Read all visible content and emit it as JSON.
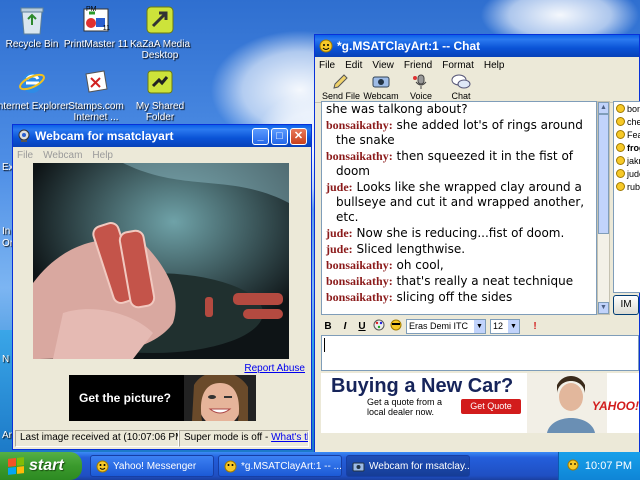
{
  "desktop": {
    "icons": [
      {
        "label": "Recycle Bin",
        "icon": "recycle-bin-icon"
      },
      {
        "label": "PrintMaster 11",
        "icon": "printmaster-icon",
        "badge_top": "PM",
        "badge_num": "11"
      },
      {
        "label": "KaZaA Media Desktop",
        "icon": "kazaa-icon"
      },
      {
        "label": "Internet Explorer",
        "icon": "ie-icon"
      },
      {
        "label": "Stamps.com Internet ...",
        "icon": "stamps-icon"
      },
      {
        "label": "My Shared Folder",
        "icon": "shared-folder-icon"
      }
    ],
    "edge_labels": [
      "Ex",
      "In",
      "Or",
      "N",
      "Ar"
    ]
  },
  "webcam_window": {
    "title": "Webcam for msatclayart",
    "menu": [
      "File",
      "Webcam",
      "Help"
    ],
    "report_abuse": "Report Abuse",
    "ad_text": "Get the picture?",
    "status_left": "Last image received at (10:07:06 PM)",
    "status_right": "Super mode is off - ",
    "status_link": "What's this?"
  },
  "chat_window": {
    "title": "*g.MSATClayArt:1  -- Chat",
    "menu": [
      "File",
      "Edit",
      "View",
      "Friend",
      "Format",
      "Help"
    ],
    "toolbar": [
      {
        "label": "Send File",
        "icon": "send-file-icon"
      },
      {
        "label": "Webcam",
        "icon": "webcam-icon"
      },
      {
        "label": "Voice",
        "icon": "microphone-icon"
      },
      {
        "label": "Chat",
        "icon": "chat-bubbles-icon"
      }
    ],
    "messages": [
      {
        "who": "",
        "text": "she was talkong about?"
      },
      {
        "who": "bonsaikathy:",
        "text": "she added lot's of rings around the snake"
      },
      {
        "who": "bonsaikathy:",
        "text": "then squeezed it in the fist of doom"
      },
      {
        "who": "jude:",
        "text": "Looks like she wrapped clay around a bullseye and cut it and wrapped another, etc."
      },
      {
        "who": "jude:",
        "text": "Now she is reducing...fist of doom."
      },
      {
        "who": "jude:",
        "text": "Sliced lengthwise."
      },
      {
        "who": "bonsaikathy:",
        "text": "oh cool,"
      },
      {
        "who": "bonsaikathy:",
        "text": "that's really a neat technique"
      },
      {
        "who": "bonsaikathy:",
        "text": "slicing off the sides"
      }
    ],
    "friends": [
      {
        "name": "bonsa",
        "bold": false
      },
      {
        "name": "chelyh",
        "bold": false
      },
      {
        "name": "Fearle",
        "bold": false
      },
      {
        "name": "frogg",
        "bold": true
      },
      {
        "name": "jakmia",
        "bold": false
      },
      {
        "name": "jude",
        "bold": false
      },
      {
        "name": "rubens",
        "bold": false
      }
    ],
    "im_button": "IM",
    "format": {
      "bold": "B",
      "italic": "I",
      "underline": "U",
      "font": "Eras Demi ITC",
      "size": "12"
    },
    "input_value": "",
    "ad": {
      "headline": "Buying a New Car?",
      "sub": "Get a quote from a local dealer now.",
      "button": "Get Quote",
      "brand": "YAHOO!"
    }
  },
  "taskbar": {
    "start": "start",
    "tasks": [
      {
        "label": "Yahoo! Messenger",
        "active": false
      },
      {
        "label": "*g.MSATClayArt:1 -- ...",
        "active": false
      },
      {
        "label": "Webcam for msatclay...",
        "active": true
      }
    ],
    "clock": "10:07 PM"
  },
  "colors": {
    "xp_blue": "#0a5fe8",
    "chat_name": "#8b1a1a",
    "start_green": "#3a9a2c"
  }
}
